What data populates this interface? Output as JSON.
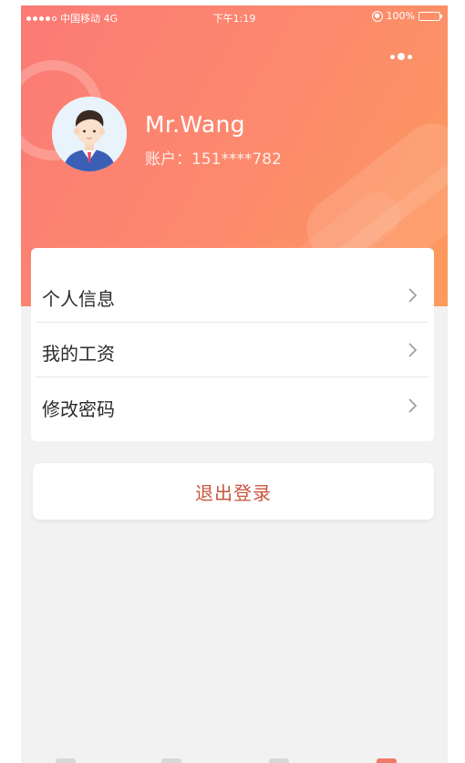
{
  "status_bar": {
    "carrier": "中国移动 4G",
    "time": "下午1:19",
    "battery": "100%"
  },
  "header": {
    "more_icon": "more-icon"
  },
  "profile": {
    "name": "Mr.Wang",
    "account": "账户：151****782"
  },
  "menu": {
    "items": [
      {
        "label": "个人信息"
      },
      {
        "label": "我的工资"
      },
      {
        "label": "修改密码"
      }
    ]
  },
  "logout": {
    "label": "退出登录"
  },
  "colors": {
    "header_gradient_start": "#fb7a76",
    "header_gradient_end": "#fd9a5c",
    "logout_text": "#c9553f",
    "page_background": "#f2f2f2"
  }
}
